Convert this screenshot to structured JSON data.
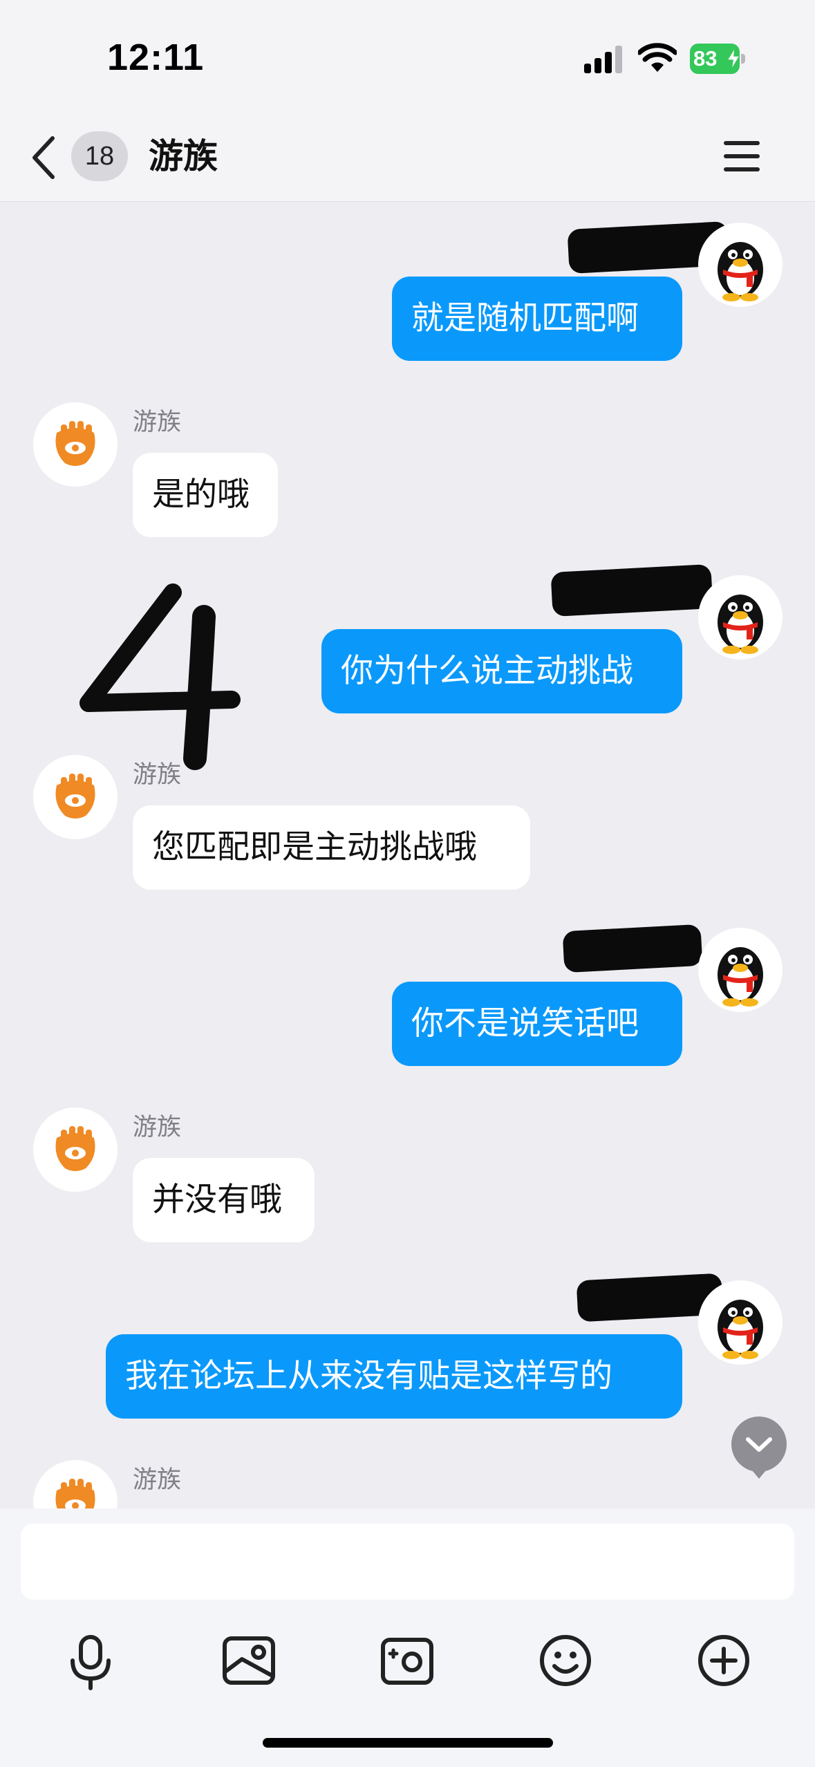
{
  "status_bar": {
    "time": "12:11",
    "battery_level": "83",
    "battery_color": "#34c759",
    "icons": [
      "cellular-signal-icon",
      "wifi-icon",
      "battery-charging-icon"
    ]
  },
  "nav": {
    "back_icon": "chevron-left-icon",
    "unread_count": "18",
    "title": "游族",
    "menu_icon": "hamburger-menu-icon"
  },
  "colors": {
    "outgoing_bubble": "#0a99fb",
    "incoming_bubble": "#ffffff",
    "chat_background": "#ededf2",
    "brand_orange": "#f08a24"
  },
  "messages": [
    {
      "direction": "outgoing",
      "sender_redacted": true,
      "text": "就是随机匹配啊"
    },
    {
      "direction": "incoming",
      "sender": "游族",
      "text": "是的哦"
    },
    {
      "direction": "outgoing",
      "sender_redacted": true,
      "text": "你为什么说主动挑战"
    },
    {
      "direction": "incoming",
      "sender": "游族",
      "text": "您匹配即是主动挑战哦"
    },
    {
      "direction": "outgoing",
      "sender_redacted": true,
      "text": "你不是说笑话吧"
    },
    {
      "direction": "incoming",
      "sender": "游族",
      "text": "并没有哦"
    },
    {
      "direction": "outgoing",
      "sender_redacted": true,
      "text": "我在论坛上从来没有贴是这样写的"
    },
    {
      "direction": "incoming",
      "sender": "游族",
      "text": ""
    }
  ],
  "composer": {
    "input_value": "",
    "tools": [
      "microphone-icon",
      "image-icon",
      "camera-icon",
      "emoji-icon",
      "plus-icon"
    ]
  }
}
